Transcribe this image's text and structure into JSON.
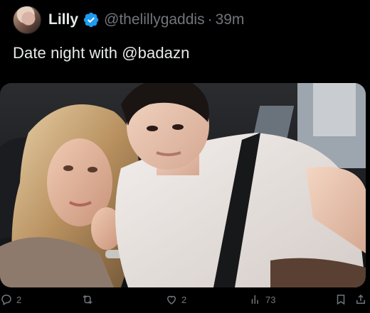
{
  "tweet": {
    "author_name": "Lilly",
    "handle": "@thelillygaddis",
    "separator": "·",
    "time": "39m",
    "text": "Date night with @badazn"
  },
  "actions": {
    "reply_count": "2",
    "like_count": "2",
    "view_count": "73"
  },
  "icons": {
    "reply": "reply-icon",
    "retweet": "retweet-icon",
    "like": "heart-icon",
    "views": "analytics-icon",
    "bookmark": "bookmark-icon",
    "share": "share-icon",
    "verified": "verified-badge-icon"
  },
  "colors": {
    "background": "#000000",
    "text": "#e7e9ea",
    "muted": "#71767b",
    "verified": "#1d9bf0"
  }
}
